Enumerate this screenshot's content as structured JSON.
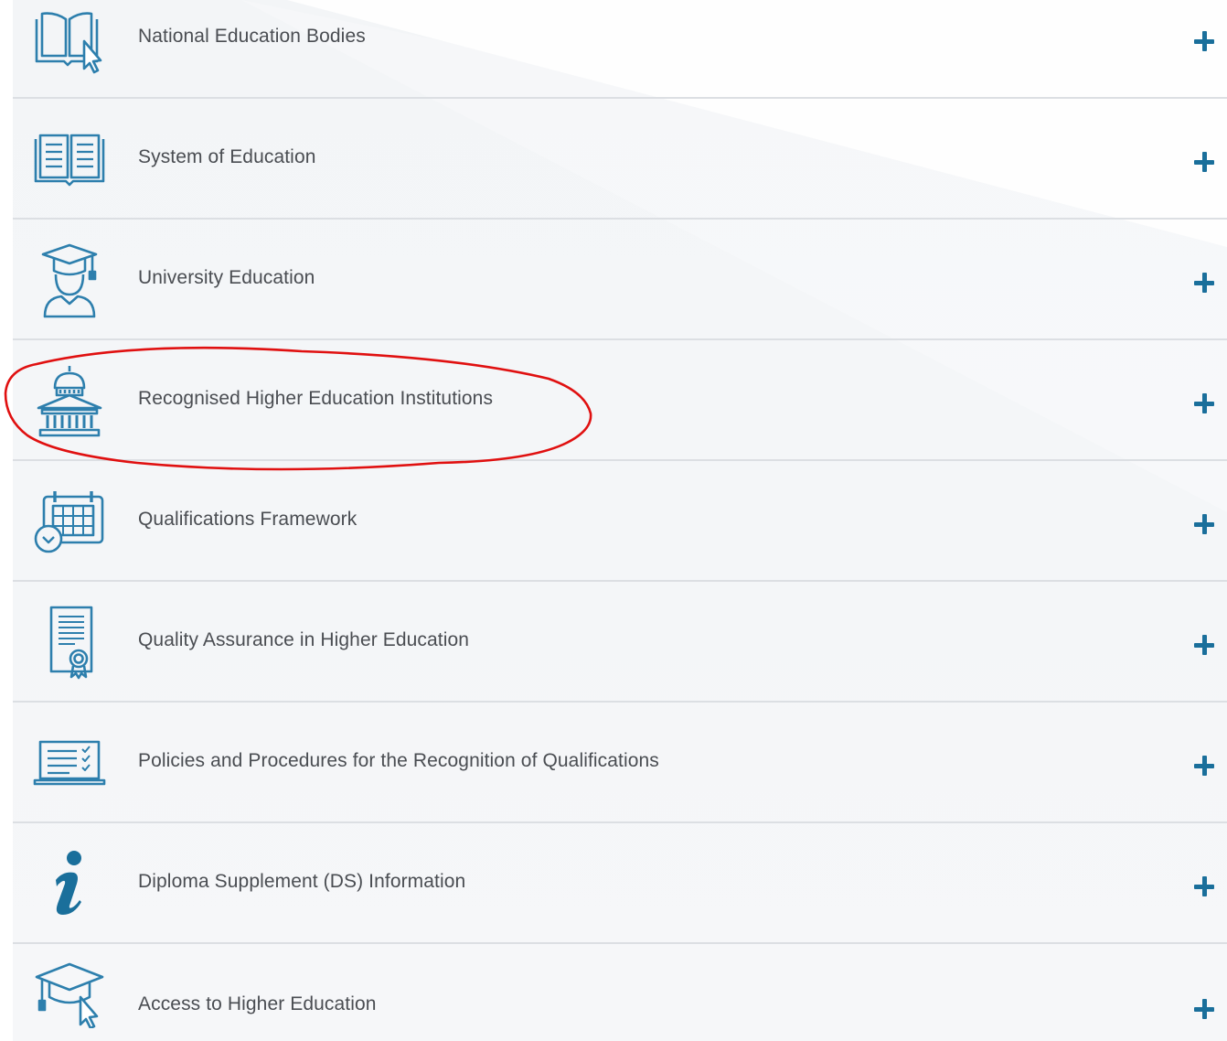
{
  "accordion": {
    "items": [
      {
        "label": "National Education Bodies",
        "icon": "book-cursor-icon"
      },
      {
        "label": "System of Education",
        "icon": "open-book-icon"
      },
      {
        "label": "University Education",
        "icon": "graduate-student-icon"
      },
      {
        "label": "Recognised Higher Education Institutions",
        "icon": "university-building-icon"
      },
      {
        "label": "Qualifications Framework",
        "icon": "calendar-clock-icon"
      },
      {
        "label": "Quality Assurance in Higher Education",
        "icon": "certificate-icon"
      },
      {
        "label": "Policies and Procedures for the Recognition of Qualifications",
        "icon": "laptop-checklist-icon"
      },
      {
        "label": "Diploma Supplement (DS) Information",
        "icon": "info-icon"
      },
      {
        "label": "Access to Higher Education",
        "icon": "graduation-cap-cursor-icon"
      }
    ],
    "expand_icon": "plus-icon"
  },
  "colors": {
    "icon_blue": "#2d7fad",
    "plus_blue": "#1a6f9b",
    "label_text": "#4a4d52",
    "annotation_red": "#e01010"
  }
}
